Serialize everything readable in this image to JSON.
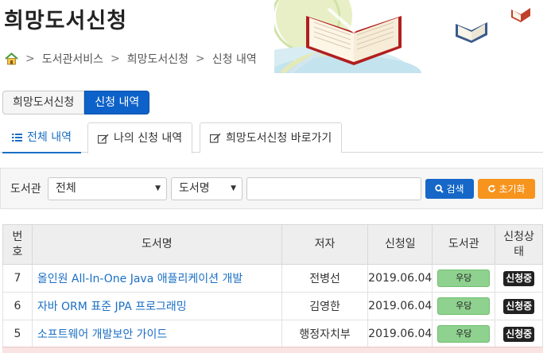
{
  "page": {
    "title": "희망도서신청",
    "breadcrumb": [
      "도서관서비스",
      "희망도서신청",
      "신청 내역"
    ]
  },
  "segments": [
    "희망도서신청",
    "신청 내역"
  ],
  "tabs": [
    {
      "label": "전체 내역",
      "icon": "list-icon"
    },
    {
      "label": "나의 신청 내역",
      "icon": "edit-icon"
    },
    {
      "label": "희망도서신청 바로가기",
      "icon": "edit-icon"
    }
  ],
  "search": {
    "library_label": "도서관",
    "library_selected": "전체",
    "field_selected": "도서명",
    "query_value": "",
    "search_label": "검색",
    "reset_label": "초기화"
  },
  "table": {
    "headers": {
      "no_line1": "번",
      "no_line2": "호",
      "title": "도서명",
      "author": "저자",
      "date": "신청일",
      "library": "도서관",
      "status_line1": "신청상",
      "status_line2": "태"
    },
    "rows": [
      {
        "no": "7",
        "title": "올인원 All-In-One Java 애플리케이션 개발",
        "author": "전병선",
        "date": "2019.06.04",
        "library": "우당",
        "status": "신청중"
      },
      {
        "no": "6",
        "title": "자바 ORM 표준 JPA 프로그래밍",
        "author": "김영한",
        "date": "2019.06.04",
        "library": "우당",
        "status": "신청중"
      },
      {
        "no": "5",
        "title": "소프트웨어 개발보안 가이드",
        "author": "행정자치부",
        "date": "2019.06.04",
        "library": "우당",
        "status": "신청중"
      }
    ]
  },
  "colors": {
    "primary": "#0d62c9",
    "link": "#1a6fc4",
    "reset": "#f7941d",
    "library_badge": "#8fd18f",
    "status_badge": "#222222"
  }
}
